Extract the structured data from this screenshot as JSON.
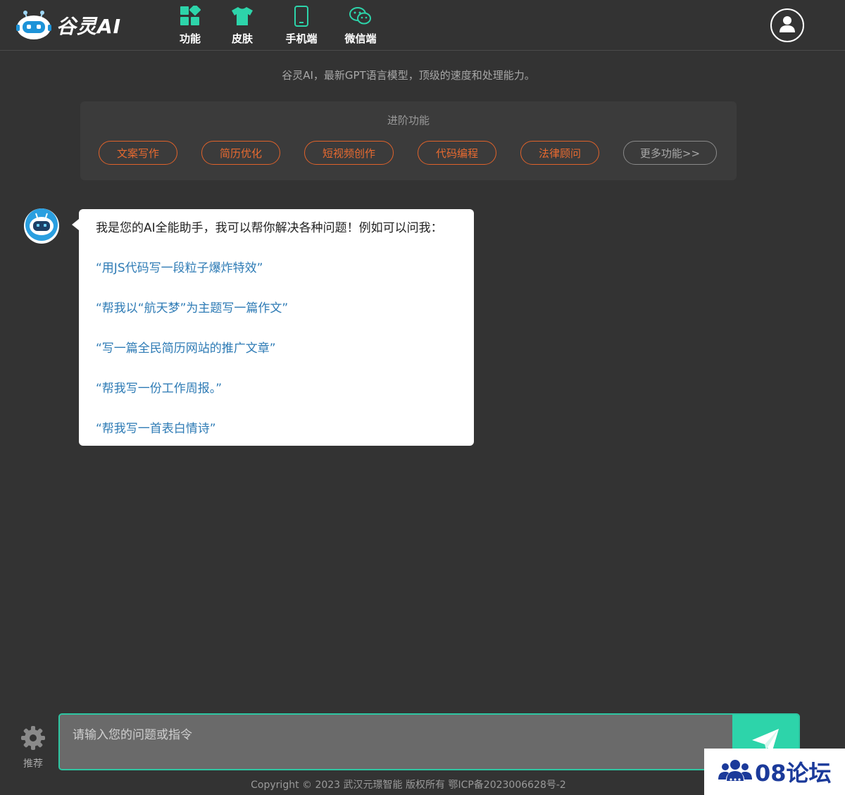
{
  "header": {
    "brand": "谷灵AI",
    "nav": [
      {
        "label": "功能",
        "icon": "grid-icon"
      },
      {
        "label": "皮肤",
        "icon": "tshirt-icon"
      },
      {
        "label": "手机端",
        "icon": "phone-icon"
      },
      {
        "label": "微信端",
        "icon": "wechat-icon"
      }
    ],
    "user_icon": "user-icon"
  },
  "tagline": "谷灵AI，最新GPT语言模型，顶级的速度和处理能力。",
  "advanced": {
    "title": "进阶功能",
    "buttons": [
      "文案写作",
      "简历优化",
      "短视频创作",
      "代码编程",
      "法律顾问"
    ],
    "more": "更多功能>>"
  },
  "chat": {
    "intro": "我是您的AI全能助手，我可以帮你解决各种问题！例如可以问我：",
    "suggestions": [
      "“用JS代码写一段粒子爆炸特效”",
      "“帮我以“航天梦”为主题写一篇作文”",
      "“写一篇全民简历网站的推广文章”",
      "“帮我写一份工作周报。”",
      "“帮我写一首表白情诗”"
    ]
  },
  "composer": {
    "settings_label": "推荐",
    "placeholder": "请输入您的问题或指令",
    "value": ""
  },
  "footer": {
    "copyright": "Copyright © 2023 武汉元璟智能 版权所有 鄂ICP备2023006628号-2"
  },
  "watermark": {
    "text": "08论坛"
  },
  "colors": {
    "background": "#333333",
    "accent_orange": "#e86a30",
    "accent_green": "#2dd4aa",
    "link_blue": "#2e7bb5"
  }
}
